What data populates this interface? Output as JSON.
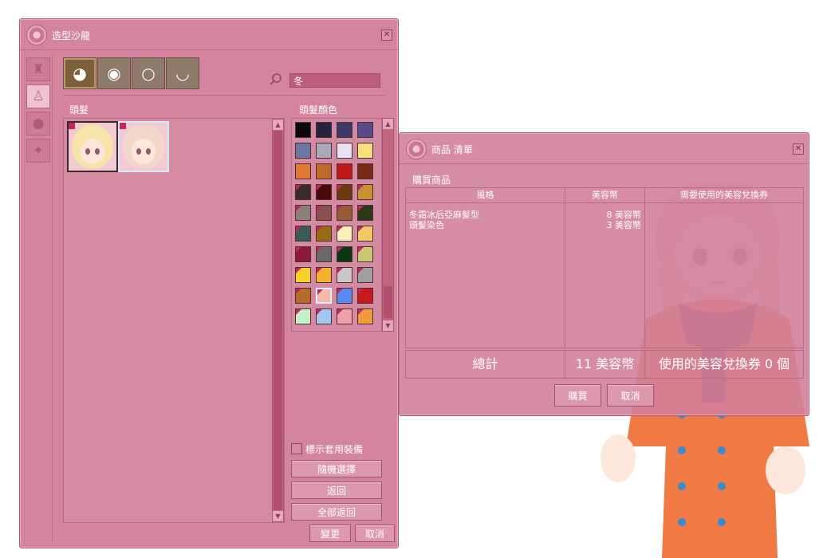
{
  "main_window": {
    "title": "造型沙龍",
    "search_value": "冬",
    "hair_label": "頭髮",
    "hair_color_label": "頭髮顏色",
    "show_equipped_label": "標示套用裝備",
    "random_button": "隨機選擇",
    "back_button": "返回",
    "back_all_button": "全部返回",
    "change_button": "變更",
    "cancel_button": "取消",
    "tabs": [
      {
        "icon": "hair-icon",
        "active": true
      },
      {
        "icon": "eye-icon",
        "active": false
      },
      {
        "icon": "face-icon",
        "active": false
      },
      {
        "icon": "mouth-icon",
        "active": false
      }
    ],
    "left_buttons": [
      {
        "icon": "clothing-icon",
        "active": false
      },
      {
        "icon": "body-icon",
        "active": true
      },
      {
        "icon": "head-accessory-icon",
        "active": false
      },
      {
        "icon": "effect-icon",
        "active": false
      }
    ],
    "hair_styles": [
      {
        "name": "hairstyle-1",
        "selected": false
      },
      {
        "name": "hairstyle-2",
        "selected": true
      }
    ],
    "hair_colors": [
      {
        "color": "#0a0a0a",
        "flag": false
      },
      {
        "color": "#262340",
        "flag": false
      },
      {
        "color": "#3d3a66",
        "flag": false
      },
      {
        "color": "#5a4a8c",
        "flag": false
      },
      {
        "color": "#6b78a0",
        "flag": false
      },
      {
        "color": "#a8a8b8",
        "flag": false
      },
      {
        "color": "#e8e0f4",
        "flag": false
      },
      {
        "color": "#f6e07a",
        "flag": false
      },
      {
        "color": "#e07a33",
        "flag": false
      },
      {
        "color": "#c06a2a",
        "flag": false
      },
      {
        "color": "#c01818",
        "flag": false
      },
      {
        "color": "#7a2a14",
        "flag": false
      },
      {
        "color": "#3a2a2a",
        "flag": true
      },
      {
        "color": "#4a0a0a",
        "flag": true
      },
      {
        "color": "#6a3a10",
        "flag": true
      },
      {
        "color": "#c8902e",
        "flag": true
      },
      {
        "color": "#8a8078",
        "flag": true
      },
      {
        "color": "#8a5050",
        "flag": true
      },
      {
        "color": "#9a5a3a",
        "flag": true
      },
      {
        "color": "#2a3a14",
        "flag": true
      },
      {
        "color": "#3a5a5a",
        "flag": true
      },
      {
        "color": "#9a6a10",
        "flag": true
      },
      {
        "color": "#f6f0b8",
        "flag": true
      },
      {
        "color": "#f2c866",
        "flag": true
      },
      {
        "color": "#8a1a3a",
        "flag": true
      },
      {
        "color": "#6a6a6a",
        "flag": true
      },
      {
        "color": "#0a3a14",
        "flag": true
      },
      {
        "color": "#c8c870",
        "flag": true
      },
      {
        "color": "#f6d22a",
        "flag": true
      },
      {
        "color": "#f2b230",
        "flag": true
      },
      {
        "color": "#c8c8c8",
        "flag": true
      },
      {
        "color": "#a0a0a0",
        "flag": true
      },
      {
        "color": "#b86a2a",
        "flag": true
      },
      {
        "color": "#f6b8a8",
        "flag": true
      },
      {
        "color": "#5a8af0",
        "flag": true
      },
      {
        "color": "#c81a1a",
        "flag": true
      },
      {
        "color": "#c8f0c8",
        "flag": true
      },
      {
        "color": "#a0c8f0",
        "flag": true
      },
      {
        "color": "#f0a0a8",
        "flag": true
      },
      {
        "color": "#f29a3a",
        "flag": true
      }
    ],
    "selected_color_index": 33
  },
  "shop_window": {
    "title": "商品 清單",
    "buy_items_label": "購買商品",
    "col_style": "風格",
    "col_price": "美容幣",
    "col_coupon": "需要使用的美容兌換券",
    "rows": [
      {
        "style": "冬霜冰后亞麻髮型",
        "price": "8 美容幣",
        "coupon": ""
      },
      {
        "style": "頭髮染色",
        "price": "3 美容幣",
        "coupon": ""
      }
    ],
    "total_label": "總計",
    "total_price": "11 美容幣",
    "coupon_used": "使用的美容兌換券 0 個",
    "buy_button": "購買",
    "cancel_button": "取消"
  },
  "colors": {
    "window_bg": "#d4849c",
    "window_border": "#a65a74",
    "coat": "#f07a44",
    "button_face": "#dc98ad"
  }
}
